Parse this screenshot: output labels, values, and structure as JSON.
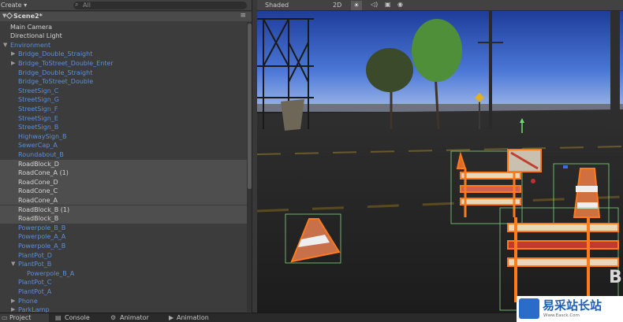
{
  "hierarchy": {
    "toolbar": {
      "create_label": "Create ▾",
      "search_icon": "search-icon",
      "search_placeholder": "All"
    },
    "scene": {
      "name": "Scene2*",
      "menu_icon": "menu-icon"
    },
    "items": [
      {
        "label": "Main Camera",
        "color": "white",
        "indent": 0,
        "fold": "",
        "selected": false
      },
      {
        "label": "Directional Light",
        "color": "white",
        "indent": 0,
        "fold": "",
        "selected": false
      },
      {
        "label": "Environment",
        "color": "blue",
        "indent": 0,
        "fold": "▼",
        "selected": false
      },
      {
        "label": "Bridge_Double_Straight",
        "color": "blue",
        "indent": 1,
        "fold": "▶",
        "selected": false
      },
      {
        "label": "Bridge_ToStreet_Double_Enter",
        "color": "blue",
        "indent": 1,
        "fold": "▶",
        "selected": false
      },
      {
        "label": "Bridge_Double_Straight",
        "color": "blue",
        "indent": 1,
        "fold": "",
        "selected": false
      },
      {
        "label": "Bridge_ToStreet_Double",
        "color": "blue",
        "indent": 1,
        "fold": "",
        "selected": false
      },
      {
        "label": "StreetSign_C",
        "color": "blue",
        "indent": 1,
        "fold": "",
        "selected": false
      },
      {
        "label": "StreetSign_G",
        "color": "blue",
        "indent": 1,
        "fold": "",
        "selected": false
      },
      {
        "label": "StreetSign_F",
        "color": "blue",
        "indent": 1,
        "fold": "",
        "selected": false
      },
      {
        "label": "StreetSign_E",
        "color": "blue",
        "indent": 1,
        "fold": "",
        "selected": false
      },
      {
        "label": "StreetSign_B",
        "color": "blue",
        "indent": 1,
        "fold": "",
        "selected": false
      },
      {
        "label": "HighwaySign_B",
        "color": "blue",
        "indent": 1,
        "fold": "",
        "selected": false
      },
      {
        "label": "SewerCap_A",
        "color": "blue",
        "indent": 1,
        "fold": "",
        "selected": false
      },
      {
        "label": "Roundabout_B",
        "color": "blue",
        "indent": 1,
        "fold": "",
        "selected": false
      },
      {
        "label": "RoadBlock_D",
        "color": "white",
        "indent": 1,
        "fold": "",
        "selected": true
      },
      {
        "label": "RoadCone_A (1)",
        "color": "white",
        "indent": 1,
        "fold": "",
        "selected": true
      },
      {
        "label": "RoadCone_D",
        "color": "white",
        "indent": 1,
        "fold": "",
        "selected": true
      },
      {
        "label": "RoadCone_C",
        "color": "white",
        "indent": 1,
        "fold": "",
        "selected": true
      },
      {
        "label": "RoadCone_A",
        "color": "white",
        "indent": 1,
        "fold": "",
        "selected": true
      },
      {
        "label": "RoadBlock_B (1)",
        "color": "white",
        "indent": 1,
        "fold": "",
        "selected": true
      },
      {
        "label": "RoadBlock_B",
        "color": "white",
        "indent": 1,
        "fold": "",
        "selected": true
      },
      {
        "label": "Powerpole_B_B",
        "color": "blue",
        "indent": 1,
        "fold": "",
        "selected": false
      },
      {
        "label": "Powerpole_A_A",
        "color": "blue",
        "indent": 1,
        "fold": "",
        "selected": false
      },
      {
        "label": "Powerpole_A_B",
        "color": "blue",
        "indent": 1,
        "fold": "",
        "selected": false
      },
      {
        "label": "PlantPot_D",
        "color": "blue",
        "indent": 1,
        "fold": "",
        "selected": false
      },
      {
        "label": "PlantPot_B",
        "color": "blue",
        "indent": 1,
        "fold": "▼",
        "selected": false
      },
      {
        "label": "Powerpole_B_A",
        "color": "blue",
        "indent": 2,
        "fold": "",
        "selected": false
      },
      {
        "label": "PlantPot_C",
        "color": "blue",
        "indent": 1,
        "fold": "",
        "selected": false
      },
      {
        "label": "PlantPot_A",
        "color": "blue",
        "indent": 1,
        "fold": "",
        "selected": false
      },
      {
        "label": "Phone",
        "color": "blue",
        "indent": 1,
        "fold": "▶",
        "selected": false
      },
      {
        "label": "ParkLamp",
        "color": "blue",
        "indent": 1,
        "fold": "▶",
        "selected": false
      }
    ]
  },
  "scene_view": {
    "draw_mode": "Shaded",
    "btn_2d": "2D",
    "light_icon": "sun-icon",
    "audio_icon": "speaker-icon",
    "fx_icon": "image-icon",
    "camera_icon": "camera-icon"
  },
  "bottom_tabs": [
    {
      "label": "Project",
      "icon": "folder-icon",
      "active": true
    },
    {
      "label": "Console",
      "icon": "console-icon",
      "active": false
    },
    {
      "label": "Animator",
      "icon": "animator-icon",
      "active": false
    },
    {
      "label": "Animation",
      "icon": "animation-icon",
      "active": false
    }
  ],
  "watermark": {
    "title": "易采站长站",
    "url": "Www.Easck.Com"
  },
  "colors": {
    "hierarchy_bg": "#3c3c3c",
    "prefab_blue": "#5c8fd6",
    "selection_outline": "#ff7a1a",
    "bounds_green": "#7fd67f"
  }
}
